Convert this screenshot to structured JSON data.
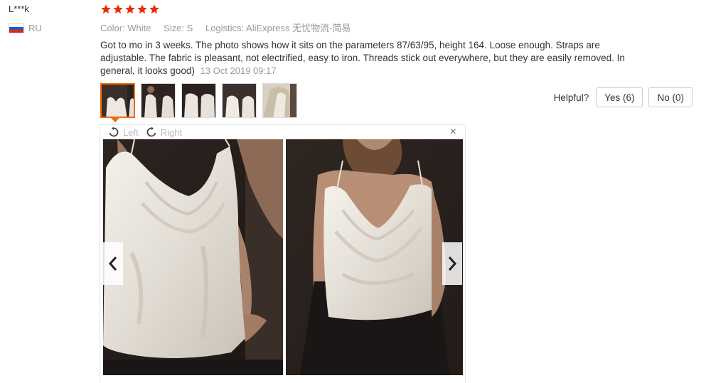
{
  "user": {
    "name": "L***k",
    "country": "RU"
  },
  "rating": {
    "stars": 5,
    "max": 5,
    "color": "#e62e04"
  },
  "attributes": {
    "color": "Color: White",
    "size": "Size: S",
    "logistics": "Logistics: AliExpress 无忧物流-简易"
  },
  "review": {
    "text": "Got to mo in 3 weeks. The photo shows how it sits on the parameters 87/63/95, height 164. Loose enough. Straps are adjustable. The fabric is pleasant, not electrified, easy to iron. Threads stick out everywhere, but they are easily removed. In general, it looks good)",
    "date": "13 Oct 2019 09:17"
  },
  "thumbnails": {
    "count": 5,
    "active_index": 0,
    "accent": "#f56a00"
  },
  "helpful": {
    "label": "Helpful?",
    "yes": "Yes (6)",
    "no": "No (0)"
  },
  "viewer": {
    "rotate_left": "Left",
    "rotate_right": "Right",
    "close": "×"
  },
  "icons": [
    "star-icon",
    "rotate-left-icon",
    "rotate-right-icon",
    "close-icon",
    "chevron-left-icon",
    "chevron-right-icon",
    "flag-icon"
  ]
}
